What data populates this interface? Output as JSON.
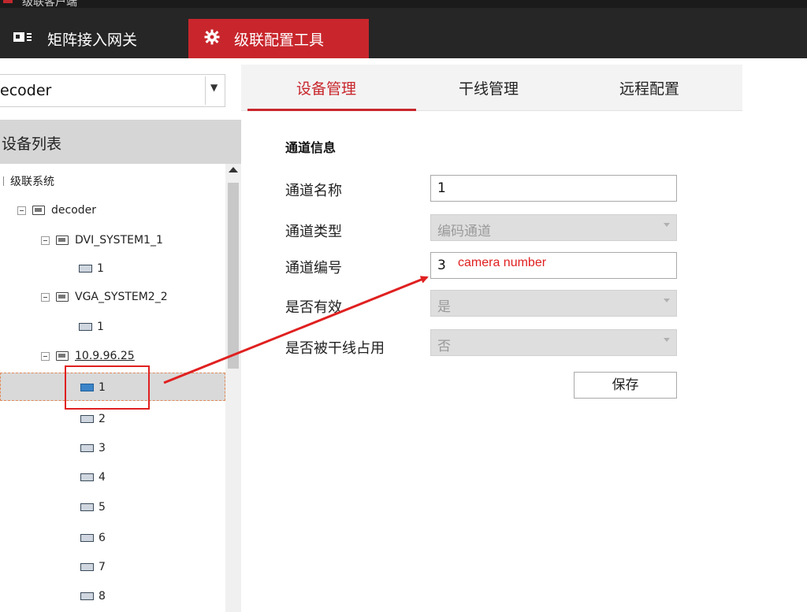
{
  "window": {
    "title": "级联客户端"
  },
  "nav": {
    "tab1": {
      "label": "矩阵接入网关",
      "icon": "matrix-gateway-icon"
    },
    "tab2": {
      "label": "级联配置工具",
      "icon": "gear-icon"
    }
  },
  "left": {
    "device_select": {
      "value": "ecoder"
    },
    "list_header": "设备列表",
    "tree": {
      "root": "级联系统",
      "decoder": "decoder",
      "dvi": "DVI_SYSTEM1_1",
      "dvi_ch": "1",
      "vga": "VGA_SYSTEM2_2",
      "vga_ch": "1",
      "ipc": "10.9.96.25",
      "ipc_channels": [
        "1",
        "2",
        "3",
        "4",
        "5",
        "6",
        "7",
        "8"
      ]
    }
  },
  "tabs": {
    "t1": "设备管理",
    "t2": "干线管理",
    "t3": "远程配置",
    "active": "设备管理"
  },
  "form": {
    "section": "通道信息",
    "name_label": "通道名称",
    "name_value": "1",
    "type_label": "通道类型",
    "type_value": "编码通道",
    "number_label": "通道编号",
    "number_value": "3",
    "number_annotation": "camera number",
    "valid_label": "是否有效",
    "valid_value": "是",
    "trunk_label": "是否被干线占用",
    "trunk_value": "否",
    "save": "保存"
  },
  "colors": {
    "accent": "#c8262c",
    "annotation": "#e02020"
  }
}
